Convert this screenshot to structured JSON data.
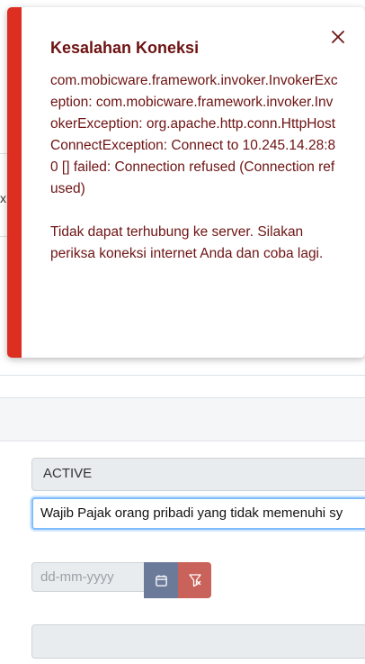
{
  "toast": {
    "title": "Kesalahan Koneksi",
    "detail": "com.mobicware.framework.invoker.InvokerException: com.mobicware.framework.invoker.InvokerException: org.apache.http.conn.HttpHostConnectException: Connect to 10.245.14.28:80 [] failed: Connection refused (Connection refused)",
    "message": "Tidak dapat terhubung ke server. Silakan periksa koneksi internet Anda dan coba lagi.",
    "accent_color": "#dc2e21",
    "text_color": "#6e1313",
    "close_icon": "close-icon"
  },
  "background": {
    "edge_char": "x"
  },
  "form": {
    "status_value": "ACTIVE",
    "description_value": "Wajib Pajak orang pribadi yang tidak memenuhi sy",
    "date_placeholder": "dd-mm-yyyy",
    "calendar_icon": "calendar-icon",
    "clear_icon": "filter-clear-icon",
    "calendar_button_color": "#6c7a99",
    "clear_button_color": "#c9625a"
  }
}
